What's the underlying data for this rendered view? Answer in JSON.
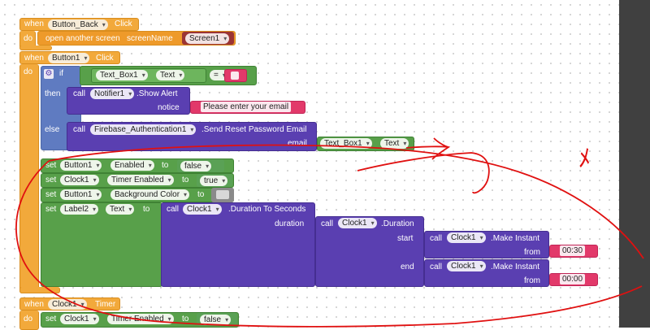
{
  "blocks": {
    "back": {
      "when": "when",
      "component": "Button_Back",
      "event": "Click",
      "do": "do",
      "action": "open another screen",
      "param": "screenName",
      "value": "Screen1"
    },
    "button1": {
      "when": "when",
      "component": "Button1",
      "event": "Click",
      "do": "do",
      "if_kw": "if",
      "then_kw": "then",
      "else_kw": "else",
      "cond_comp": "Text_Box1",
      "cond_prop": "Text",
      "cond_op": "=",
      "then_call": "call",
      "then_comp": "Notifier1",
      "then_method": ".Show Alert",
      "then_param": "notice",
      "then_value": "Please enter your email",
      "else_call": "call",
      "else_comp": "Firebase_Authentication1",
      "else_method": ".Send Reset Password Email",
      "else_param": "email",
      "else_val_comp": "Text_Box1",
      "else_val_prop": "Text",
      "set_kw": "set",
      "to_kw": "to",
      "set1_comp": "Button1",
      "set1_prop": "Enabled",
      "set1_val": "false",
      "set2_comp": "Clock1",
      "set2_prop": "Timer Enabled",
      "set2_val": "true",
      "set3_comp": "Button1",
      "set3_prop": "Background Color",
      "set4_comp": "Label2",
      "set4_prop": "Text",
      "call_kw": "call",
      "dur_comp": "Clock1",
      "dur_method": ".Duration To Seconds",
      "dur_param": "duration",
      "dur2_comp": "Clock1",
      "dur2_method": ".Duration",
      "start_param": "start",
      "end_param": "end",
      "mi_comp": "Clock1",
      "mi_method": ".Make Instant",
      "from_param": "from",
      "start_val": "00:30",
      "end_val": "00:00"
    },
    "clock": {
      "when": "when",
      "component": "Clock1",
      "event": "Timer",
      "do": "do",
      "set_kw": "set",
      "set_comp": "Clock1",
      "set_prop": "Timer Enabled",
      "to_kw": "to",
      "set_val": "false"
    }
  },
  "annotation": {
    "char": "ﾒ"
  },
  "colors": {
    "event": "#f2a93b",
    "component": "#58a04a",
    "method": "#5a3fb1",
    "text": "#e2396a",
    "annotation": "#e01010"
  }
}
